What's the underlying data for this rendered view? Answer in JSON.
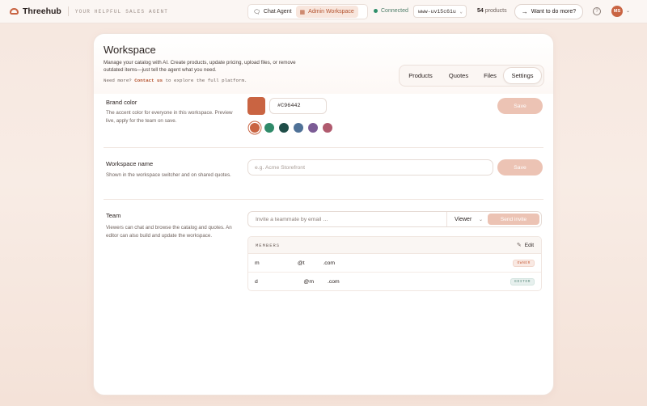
{
  "topbar": {
    "brand": "Threehub",
    "tagline": "YOUR HELPFUL SALES AGENT",
    "modes": [
      {
        "label": "Chat Agent",
        "icon": "chat-icon"
      },
      {
        "label": "Admin Workspace",
        "icon": "workspace-icon",
        "active": true
      }
    ],
    "status": "Connected",
    "workspace_id": "www-uv15c61u",
    "products_count": "54",
    "products_label": "products",
    "more_label": "Want to do more?",
    "avatar_initials": "MS"
  },
  "page": {
    "title": "Workspace",
    "description": "Manage your catalog with AI. Create products, update pricing, upload files, or remove outdated items—just tell the agent what you need.",
    "more_prefix": "Need more?",
    "more_link": "Contact us",
    "more_suffix": "to explore the full platform.",
    "tabs": [
      "Products",
      "Quotes",
      "Files",
      "Settings"
    ],
    "active_tab": "Settings"
  },
  "brand_color": {
    "title": "Brand color",
    "description": "The accent color for everyone in this workspace. Preview live, apply for the team on save.",
    "hex": "#C96442",
    "save_label": "Save",
    "palette": [
      "#c96442",
      "#2f8a69",
      "#1f4d48",
      "#4f7197",
      "#7b5b95",
      "#b05a6e"
    ]
  },
  "workspace_name": {
    "title": "Workspace name",
    "description": "Shown in the workspace switcher and on shared quotes.",
    "placeholder": "e.g. Acme Storefront",
    "save_label": "Save"
  },
  "team": {
    "title": "Team",
    "description": "Viewers can chat and browse the catalog and quotes. An editor can also build and update the workspace.",
    "invite_placeholder": "Invite a teammate by email …",
    "role": "Viewer",
    "send_label": "Send invite",
    "members_label": "MEMBERS",
    "edit_label": "Edit",
    "members": [
      {
        "email": "m                         @t            .com",
        "role": "OWNER"
      },
      {
        "email": "d                              @m         .com",
        "role": "EDITOR"
      }
    ]
  },
  "colors": {
    "accent": "#c96442",
    "accent_soft": "#ecc3b4",
    "connected": "#2f8f6b"
  }
}
